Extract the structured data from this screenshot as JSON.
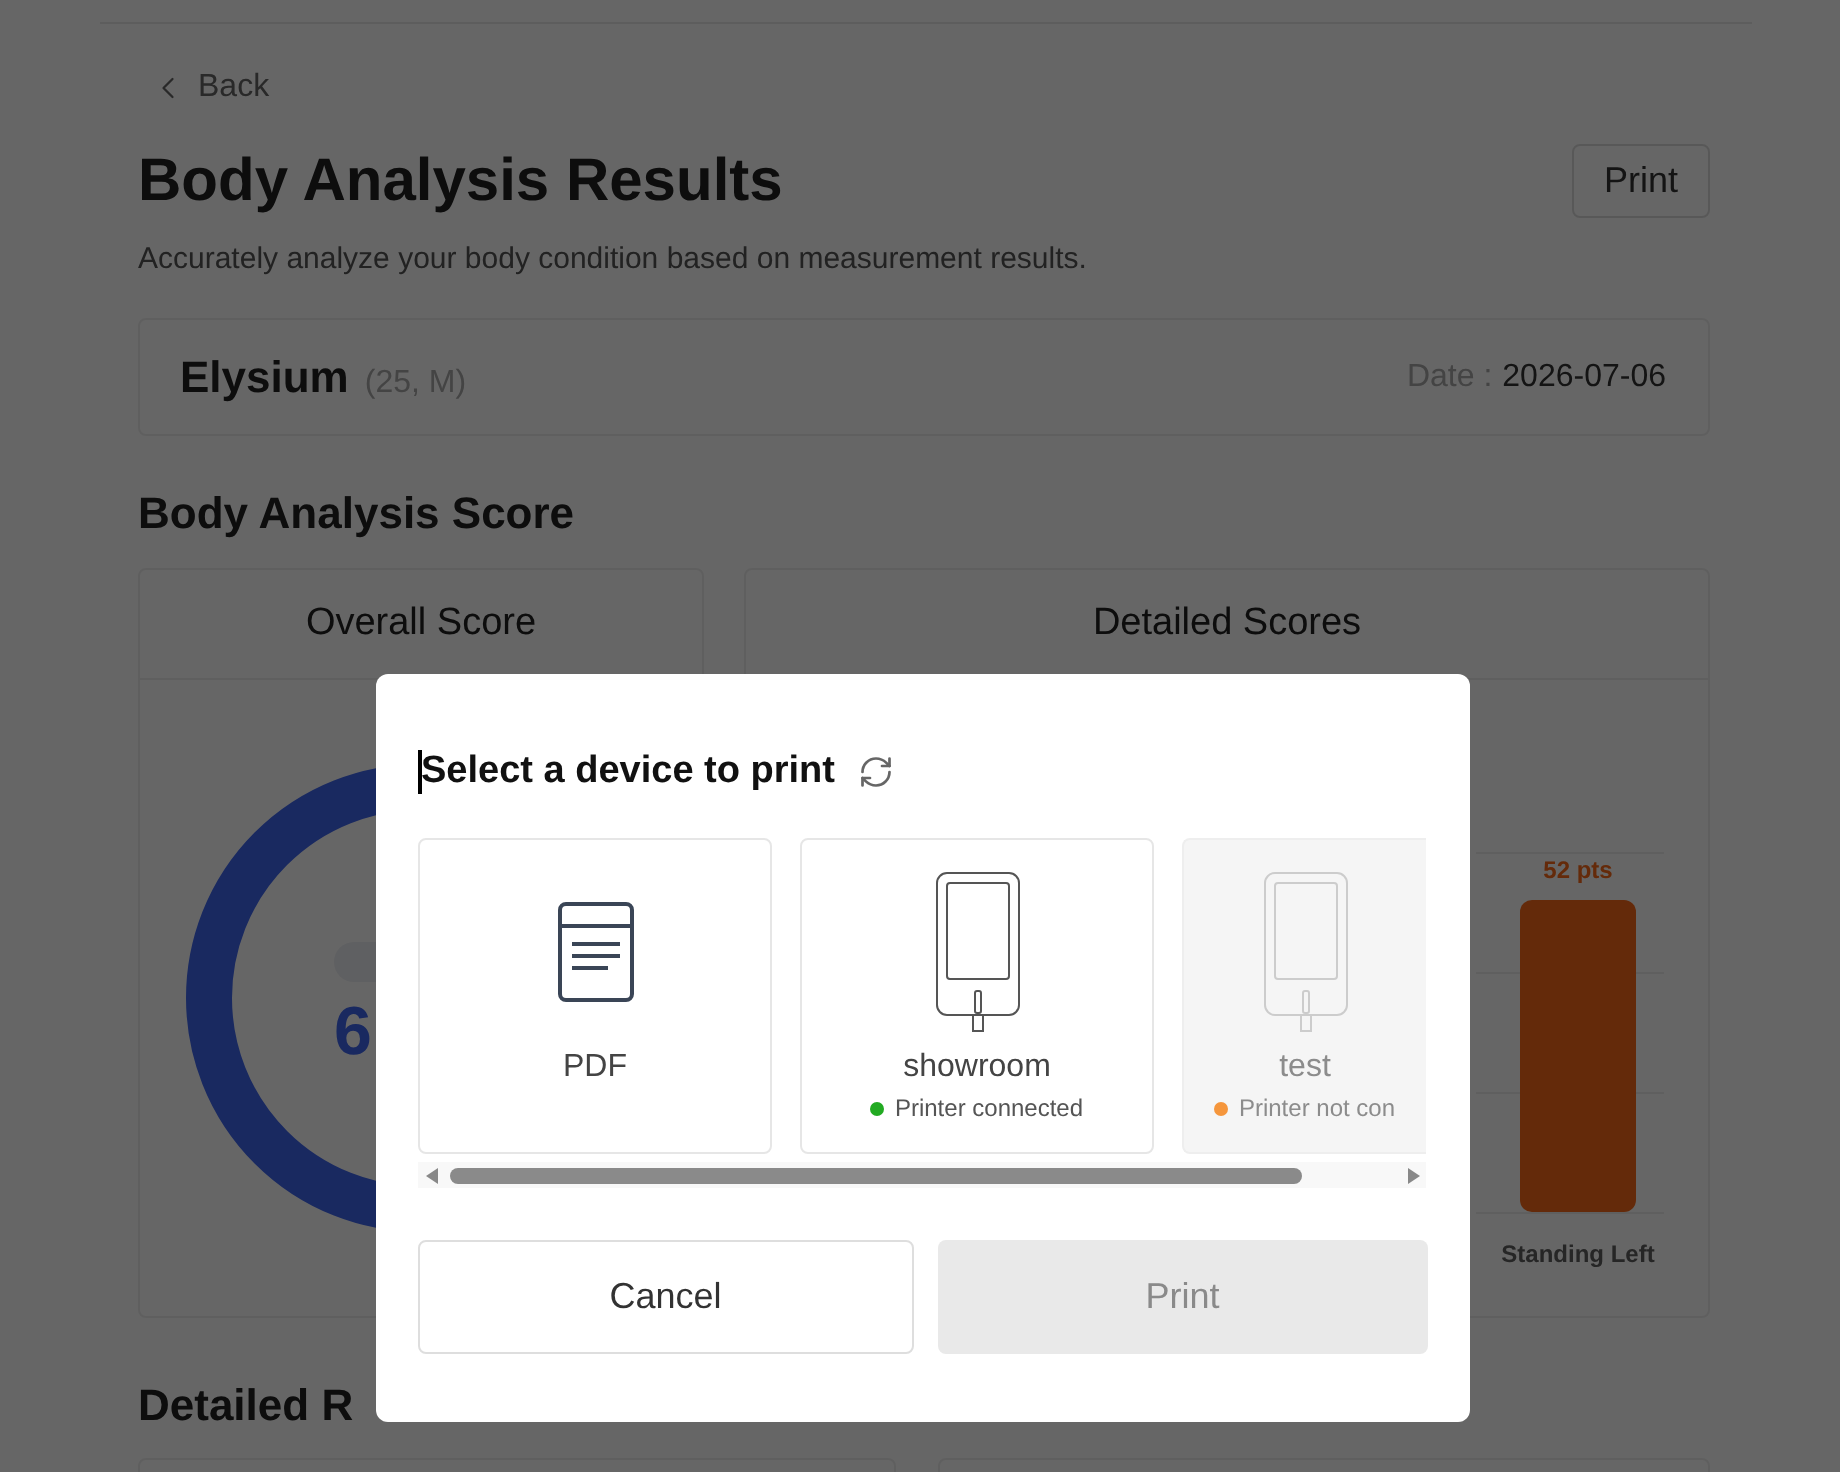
{
  "page": {
    "back": "Back",
    "title": "Body Analysis Results",
    "print_button": "Print",
    "subtitle": "Accurately analyze your body condition based on measurement results."
  },
  "profile": {
    "name": "Elysium",
    "details": "(25, M)",
    "date_label": "Date :",
    "date": "2026-07-06"
  },
  "score_section": {
    "heading": "Body Analysis Score",
    "overall": {
      "title": "Overall Score",
      "score": "6"
    },
    "detailed": {
      "title": "Detailed Scores",
      "chart_data": {
        "type": "bar",
        "categories": [
          "Standing Left"
        ],
        "values": [
          52
        ],
        "value_labels": [
          "52 pts"
        ]
      }
    }
  },
  "results_section": {
    "heading": "Detailed R"
  },
  "dialog": {
    "title": "Select a device to print",
    "devices": [
      {
        "kind": "pdf",
        "name": "PDF",
        "selected": false,
        "disabled": false
      },
      {
        "kind": "printer",
        "name": "showroom",
        "status": "Printer connected",
        "color": "#22aa22",
        "selected": false,
        "disabled": false
      },
      {
        "kind": "printer",
        "name": "test",
        "status": "Printer not con",
        "color": "#f5963c",
        "selected": false,
        "disabled": true
      }
    ],
    "buttons": [
      {
        "kind": "cancel",
        "label": "Cancel",
        "disabled": false
      },
      {
        "kind": "confirm",
        "label": "Print",
        "disabled": true
      }
    ]
  }
}
